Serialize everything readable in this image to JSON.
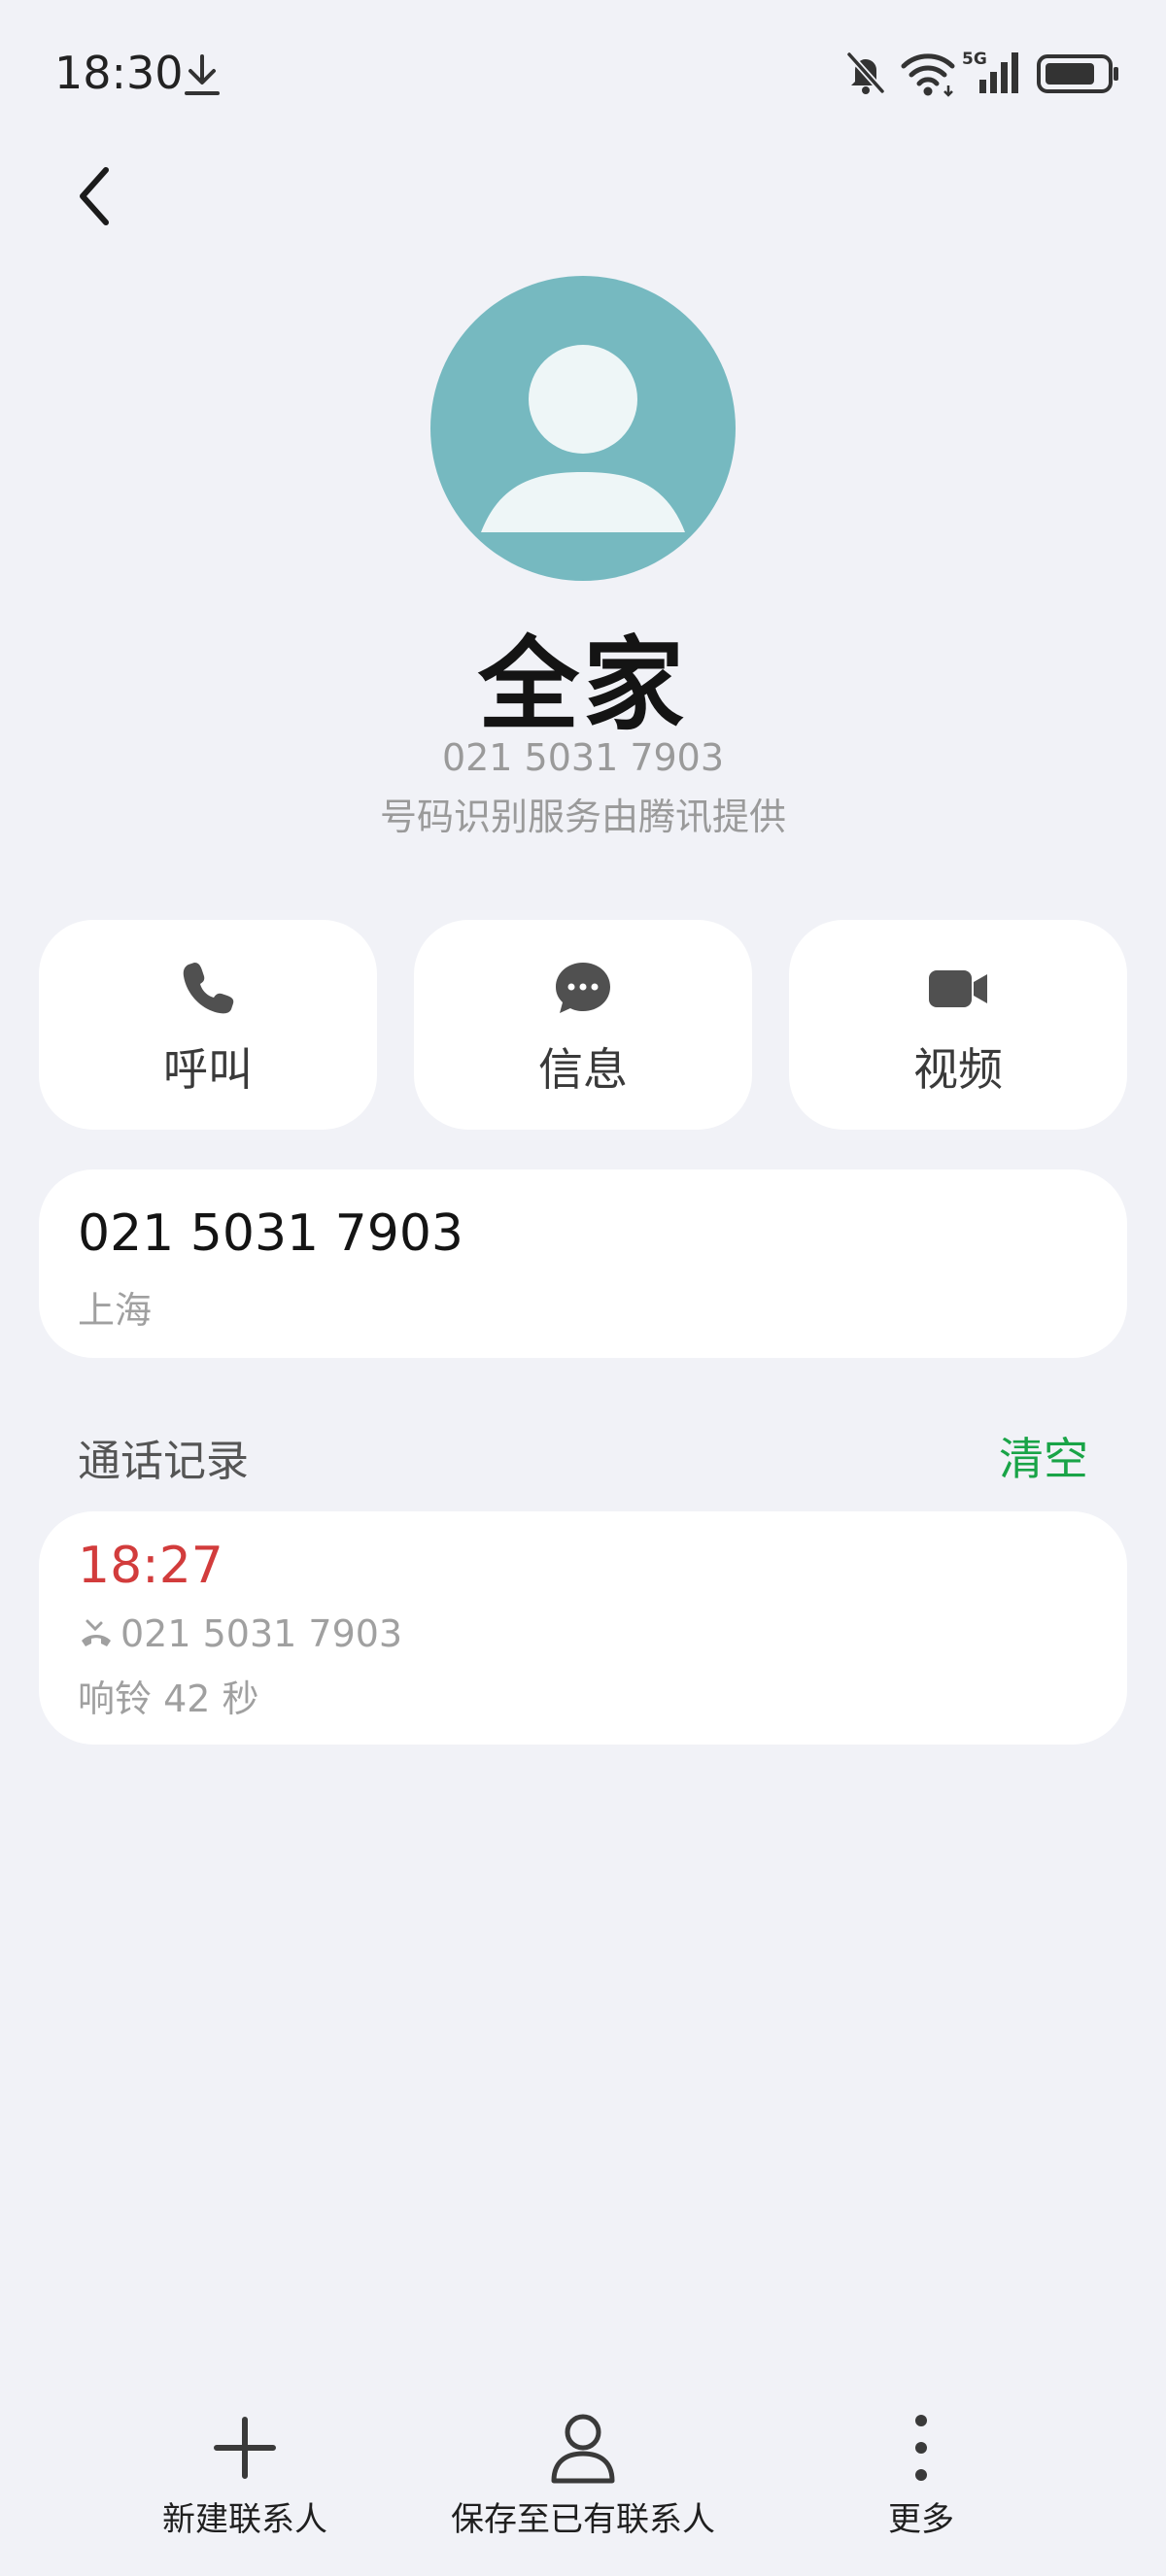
{
  "status_bar": {
    "time": "18:30",
    "icons": [
      "download-icon",
      "bell-off-icon",
      "wifi-icon",
      "5g-signal-icon",
      "battery-icon"
    ],
    "signal_label": "5G"
  },
  "header": {
    "back_icon": "chevron-left-icon"
  },
  "contact": {
    "name": "全家",
    "number": "021 5031 7903",
    "id_service": "号码识别服务由腾讯提供",
    "avatar_color": "#76b9c0"
  },
  "actions": [
    {
      "label": "呼叫",
      "icon": "phone-icon"
    },
    {
      "label": "信息",
      "icon": "message-icon"
    },
    {
      "label": "视频",
      "icon": "video-icon"
    }
  ],
  "number_card": {
    "number": "021 5031 7903",
    "location": "上海"
  },
  "call_log": {
    "title": "通话记录",
    "clear_label": "清空",
    "records": [
      {
        "time": "18:27",
        "number": "021 5031 7903",
        "detail": "响铃 42 秒",
        "status_icon": "missed-call-icon"
      }
    ]
  },
  "bottom_bar": [
    {
      "label": "新建联系人",
      "icon": "plus-icon"
    },
    {
      "label": "保存至已有联系人",
      "icon": "person-icon"
    },
    {
      "label": "更多",
      "icon": "more-vertical-icon"
    }
  ],
  "colors": {
    "background": "#f1f2f7",
    "accent_green": "#19a447",
    "missed_red": "#d23c3c",
    "card": "#ffffff"
  }
}
